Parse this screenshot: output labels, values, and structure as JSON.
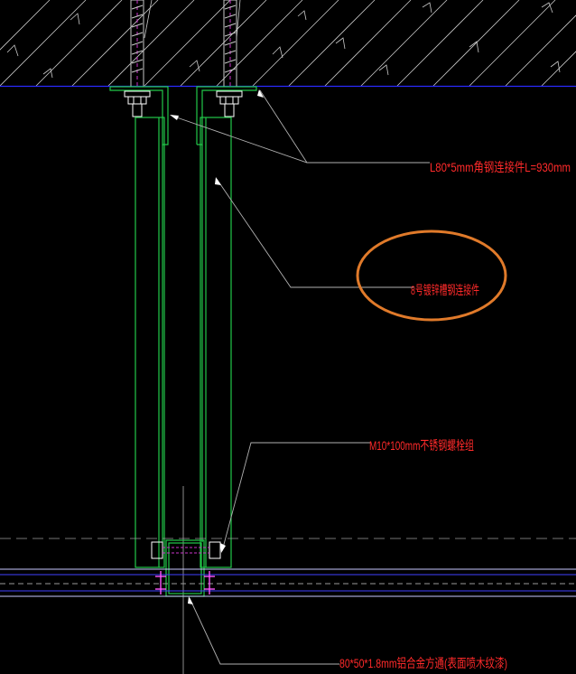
{
  "drawing": {
    "annotations": {
      "angle_steel": "L80*5mm角钢连接件L=930mm",
      "channel_steel": "8号镀锌槽钢连接件",
      "bolt": "M10*100mm不锈钢螺栓组",
      "aluminum_tube": "80*50*1.8mm铝合金方通(表面喷木纹漆)"
    },
    "colors": {
      "background": "#000000",
      "annotation_text": "#ff2a2a",
      "steel_outline": "#22c94a",
      "slab_edge": "#2a2aff",
      "leader": "#b0b0b0",
      "highlight_circle": "#e07a2a",
      "hatch": "#c8c8c8"
    }
  }
}
